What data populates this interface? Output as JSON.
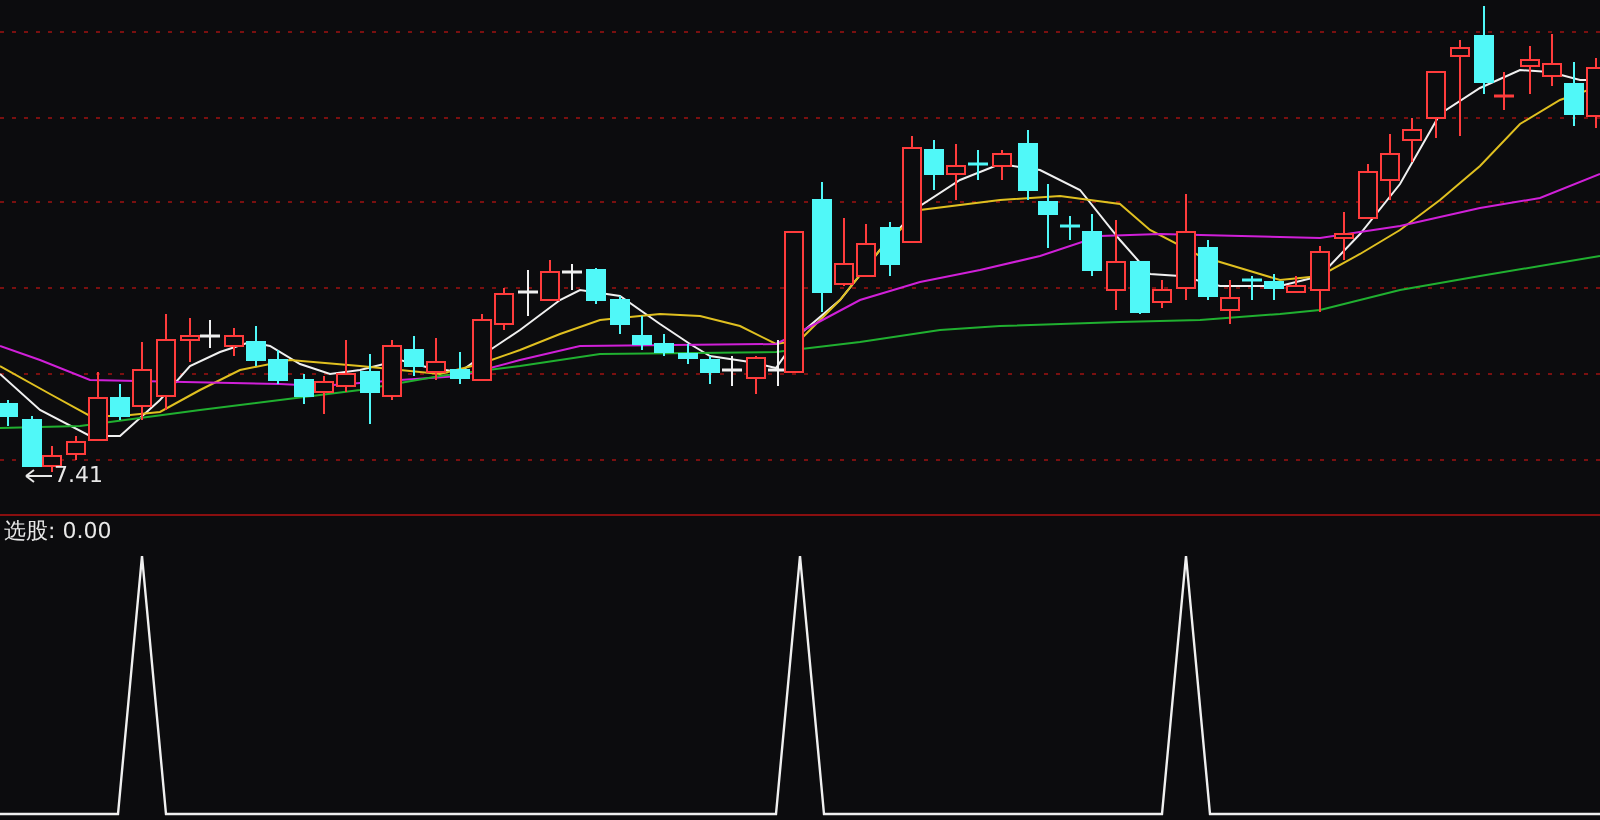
{
  "main_panel": {
    "low_marker": {
      "value": "7.41"
    }
  },
  "indicator_panel": {
    "label": "选股: 0.00"
  }
}
